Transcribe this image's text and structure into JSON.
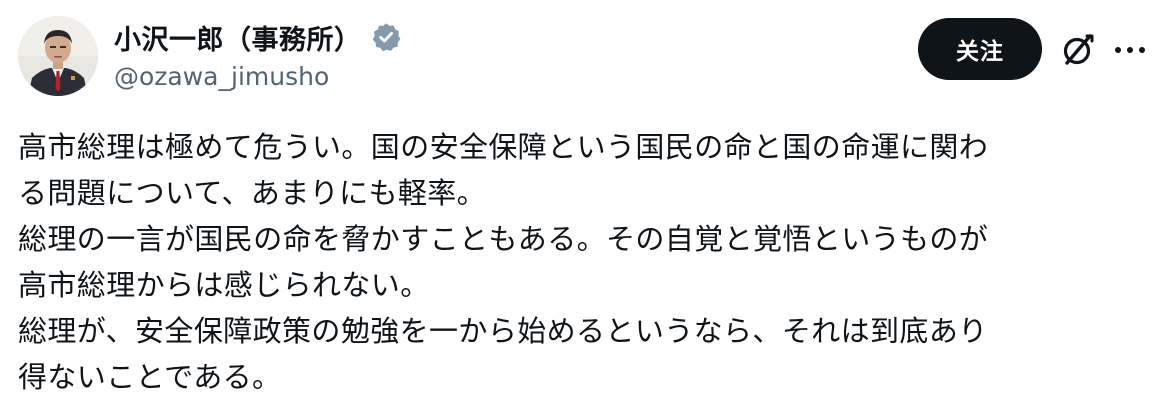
{
  "post": {
    "author": {
      "display_name": "小沢一郎（事務所）",
      "handle": "@ozawa_jimusho",
      "verified": true,
      "verified_color": "#829aab"
    },
    "actions": {
      "follow_label": "关注",
      "grok_icon": "grok-icon",
      "more_icon": "more-icon"
    },
    "text_lines": [
      "高市総理は極めて危うい。国の安全保障という国民の命と国の命運に関わ",
      "る問題について、あまりにも軽率。",
      "総理の一言が国民の命を脅かすこともある。その自覚と覚悟というものが",
      "高市総理からは感じられない。",
      "総理が、安全保障政策の勉強を一から始めるというなら、それは到底あり",
      "得ないことである。"
    ]
  }
}
